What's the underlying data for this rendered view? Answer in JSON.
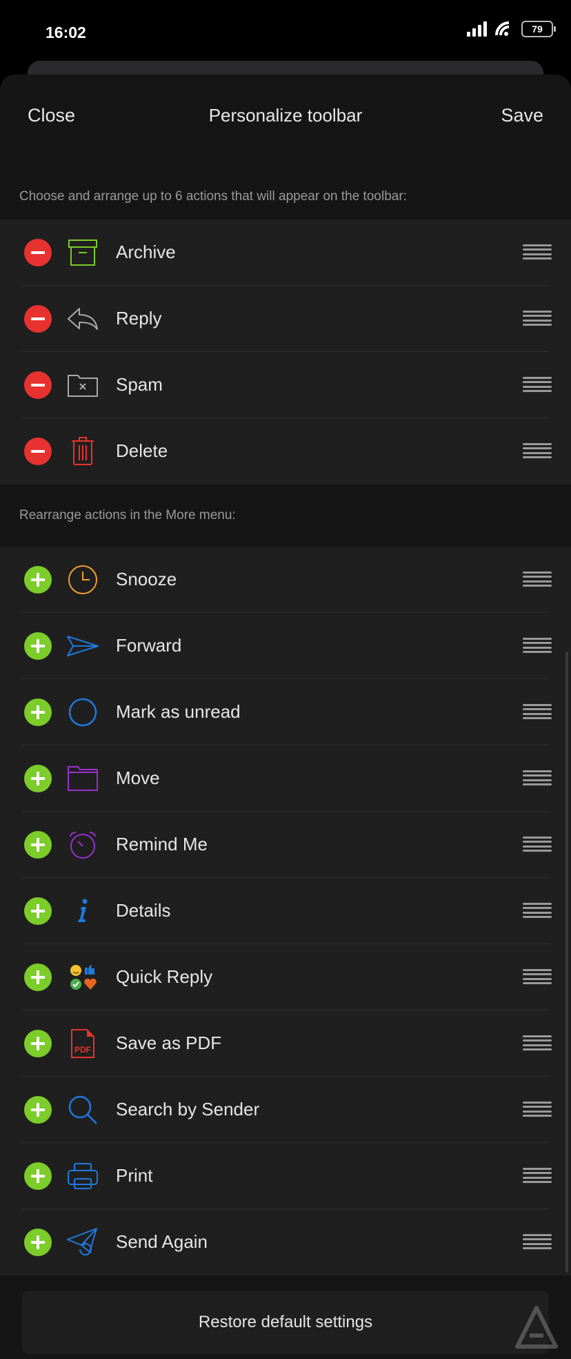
{
  "status": {
    "time": "16:02",
    "battery": "79"
  },
  "header": {
    "close": "Close",
    "title": "Personalize toolbar",
    "save": "Save"
  },
  "toolbar_section": {
    "description": "Choose and arrange up to 6 actions that will appear on the toolbar:",
    "items": [
      {
        "label": "Archive",
        "icon": "archive-icon"
      },
      {
        "label": "Reply",
        "icon": "reply-icon"
      },
      {
        "label": "Spam",
        "icon": "spam-icon"
      },
      {
        "label": "Delete",
        "icon": "delete-icon"
      }
    ]
  },
  "more_section": {
    "description": "Rearrange actions in the More menu:",
    "items": [
      {
        "label": "Snooze",
        "icon": "clock-icon"
      },
      {
        "label": "Forward",
        "icon": "forward-icon"
      },
      {
        "label": "Mark as unread",
        "icon": "circle-icon"
      },
      {
        "label": "Move",
        "icon": "folder-icon"
      },
      {
        "label": "Remind Me",
        "icon": "alarm-icon"
      },
      {
        "label": "Details",
        "icon": "info-icon"
      },
      {
        "label": "Quick Reply",
        "icon": "quick-reply-icon"
      },
      {
        "label": "Save as PDF",
        "icon": "pdf-icon",
        "icon_text": "PDF"
      },
      {
        "label": "Search by Sender",
        "icon": "search-icon"
      },
      {
        "label": "Print",
        "icon": "printer-icon"
      },
      {
        "label": "Send Again",
        "icon": "send-again-icon"
      }
    ]
  },
  "footer": {
    "restore": "Restore default settings"
  },
  "colors": {
    "remove": "#e8322f",
    "add": "#7ccc2a",
    "archive": "#7ccc2a",
    "delete": "#e8322f",
    "snooze": "#f0a030",
    "blue": "#1f7ae0",
    "purple": "#9b30d0"
  }
}
